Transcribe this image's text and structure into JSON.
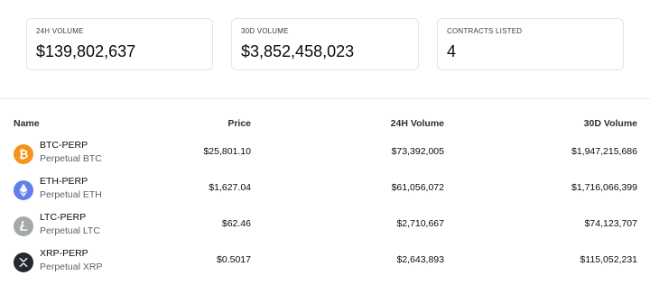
{
  "stats": [
    {
      "label": "24H VOLUME",
      "value": "$139,802,637"
    },
    {
      "label": "30D VOLUME",
      "value": "$3,852,458,023"
    },
    {
      "label": "CONTRACTS LISTED",
      "value": "4"
    }
  ],
  "table": {
    "headers": {
      "name": "Name",
      "price": "Price",
      "vol24": "24H Volume",
      "vol30": "30D Volume"
    },
    "rows": [
      {
        "symbol": "BTC-PERP",
        "desc": "Perpetual BTC",
        "price": "$25,801.10",
        "vol24": "$73,392,005",
        "vol30": "$1,947,215,686",
        "icon": "bitcoin-icon",
        "color": "#f7931a"
      },
      {
        "symbol": "ETH-PERP",
        "desc": "Perpetual ETH",
        "price": "$1,627.04",
        "vol24": "$61,056,072",
        "vol30": "$1,716,066,399",
        "icon": "ethereum-icon",
        "color": "#627eea"
      },
      {
        "symbol": "LTC-PERP",
        "desc": "Perpetual LTC",
        "price": "$62.46",
        "vol24": "$2,710,667",
        "vol30": "$74,123,707",
        "icon": "litecoin-icon",
        "color": "#a6a9aa"
      },
      {
        "symbol": "XRP-PERP",
        "desc": "Perpetual XRP",
        "price": "$0.5017",
        "vol24": "$2,643,893",
        "vol30": "$115,052,231",
        "icon": "xrp-icon",
        "color": "#23292f"
      }
    ]
  }
}
